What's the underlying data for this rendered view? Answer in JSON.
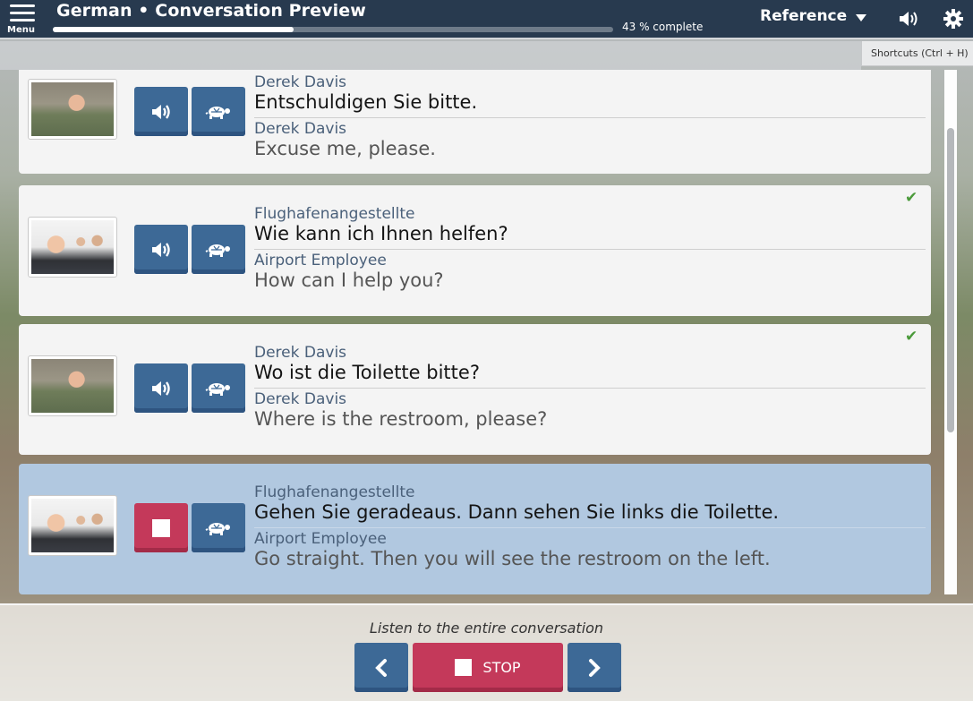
{
  "header": {
    "menu_label": "Menu",
    "title": "German • Conversation Preview",
    "progress_percent": 43,
    "progress_text": "43 % complete",
    "reference_label": "Reference",
    "icons": [
      "menu-icon",
      "chevron-down-icon",
      "speaker-icon",
      "gear-icon"
    ]
  },
  "tooltip": {
    "text": "Shortcuts (Ctrl + H)"
  },
  "conversation": [
    {
      "speaker_de": "Derek Davis",
      "text_de": "Entschuldigen Sie bitte.",
      "speaker_en": "Derek Davis",
      "text_en": "Excuse me, please.",
      "avatar": "derek",
      "completed": false,
      "active": false
    },
    {
      "speaker_de": "Flughafenangestellte",
      "text_de": "Wie kann ich Ihnen helfen?",
      "speaker_en": "Airport Employee",
      "text_en": "How can I help you?",
      "avatar": "airport-employee",
      "completed": true,
      "active": false
    },
    {
      "speaker_de": "Derek Davis",
      "text_de": "Wo ist die Toilette bitte?",
      "speaker_en": "Derek Davis",
      "text_en": "Where is the restroom, please?",
      "avatar": "derek",
      "completed": true,
      "active": false
    },
    {
      "speaker_de": "Flughafenangestellte",
      "text_de": "Gehen Sie geradeaus. Dann sehen Sie links die Toilette.",
      "speaker_en": "Airport Employee",
      "text_en": "Go straight. Then you will see the restroom on the left.",
      "avatar": "airport-employee",
      "completed": false,
      "active": true
    }
  ],
  "footer": {
    "instruction": "Listen to the entire conversation",
    "stop_label": "STOP"
  },
  "colors": {
    "header_bg": "#283a4f",
    "button_blue": "#3d6996",
    "button_red": "#c4395a",
    "active_card": "#b1c8e0",
    "check_green": "#4a9a3a"
  }
}
